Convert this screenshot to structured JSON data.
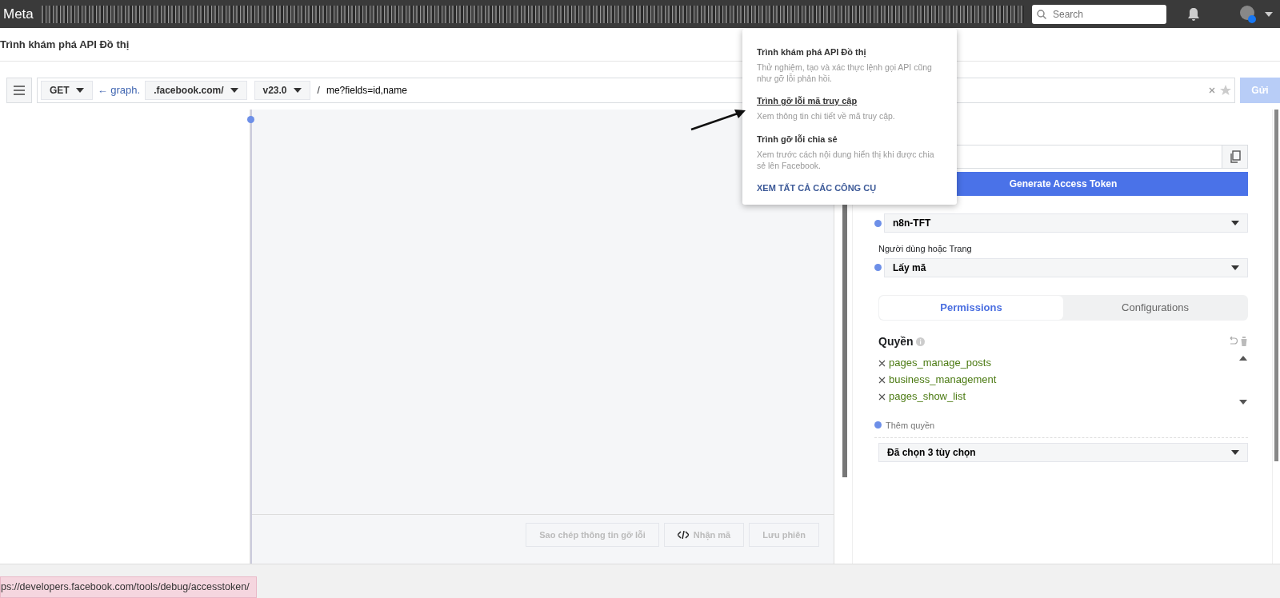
{
  "topbar": {
    "logo": "Meta",
    "search": {
      "placeholder": "Search"
    }
  },
  "page_title": "Trình khám phá API Đồ thị",
  "request": {
    "method": "GET",
    "host_prefix": "← graph.",
    "domain": ".facebook.com/",
    "version": "v23.0",
    "separator": "/",
    "path": "me?fields=id,name",
    "submit": "Gửi"
  },
  "editor_actions": [
    {
      "label": "Sao chép thông tin gỡ lỗi",
      "kind": "text",
      "disabled": true
    },
    {
      "label": "Nhận mã",
      "kind": "code",
      "disabled": true
    },
    {
      "label": "Lưu phiên",
      "kind": "text",
      "disabled": true
    }
  ],
  "token_panel": {
    "generate_button": "Generate Access Token",
    "app_select": "n8n-TFT",
    "user_label": "Người dùng hoặc Trang",
    "user_select": "Lấy mã"
  },
  "tabs": [
    {
      "label": "Permissions",
      "selected": true
    },
    {
      "label": "Configurations",
      "selected": false
    }
  ],
  "permissions": {
    "title": "Quyền",
    "items": [
      "pages_manage_posts",
      "business_management",
      "pages_show_list"
    ],
    "add_placeholder": "Thêm quyền",
    "summary": "Đã chọn 3 tùy chọn"
  },
  "menu": {
    "items": [
      {
        "title": "Trình khám phá API Đồ thị",
        "description": "Thử nghiệm, tạo và xác thực lệnh gọi API cũng như gỡ lỗi phản hồi.",
        "hovered": false
      },
      {
        "title": "Trình gỡ lỗi mã truy cập",
        "description": "Xem thông tin chi tiết về mã truy cập.",
        "hovered": true
      },
      {
        "title": "Trình gỡ lỗi chia sẻ",
        "description": "Xem trước cách nội dung hiển thị khi được chia sẻ lên Facebook.",
        "hovered": false
      }
    ],
    "link": "XEM TẤT CẢ CÁC CÔNG CỤ"
  },
  "status_url": "ps://developers.facebook.com/tools/debug/accesstoken/"
}
